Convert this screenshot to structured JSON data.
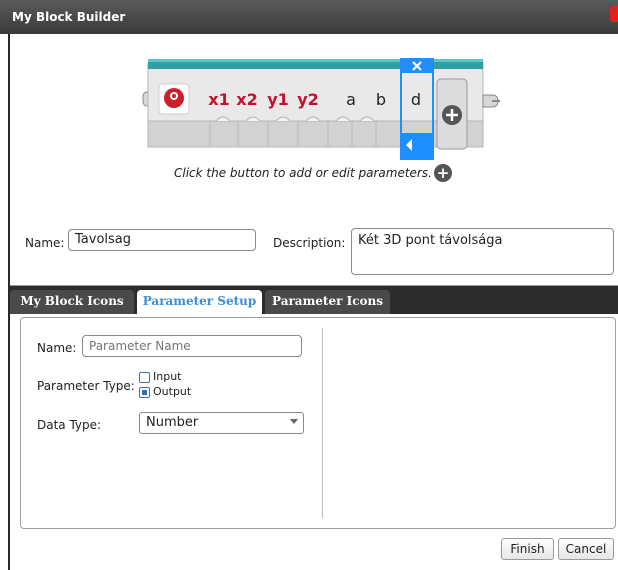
{
  "window": {
    "title": "My Block Builder"
  },
  "block": {
    "params": [
      "x1",
      "x2",
      "y1",
      "y2",
      "a",
      "b",
      "d"
    ],
    "param_colors": [
      "#c8102e",
      "#c8102e",
      "#c8102e",
      "#c8102e",
      "#222222",
      "#222222",
      "#222222"
    ],
    "selected_param_index": 6,
    "accent": "#2f9fa3",
    "selection_color": "#1f8fff"
  },
  "caption": "Click the button to add or edit parameters.",
  "name_label": "Name:",
  "name_value": "Tavolsag",
  "description_label": "Description:",
  "description_value": "Két 3D pont távolsága",
  "tabs": [
    {
      "label": "My Block Icons",
      "active": false
    },
    {
      "label": "Parameter Setup",
      "active": true
    },
    {
      "label": "Parameter Icons",
      "active": false
    }
  ],
  "param_setup": {
    "name_label": "Name:",
    "name_placeholder": "Parameter Name",
    "type_label": "Parameter Type:",
    "type_options": [
      {
        "label": "Input",
        "checked": false
      },
      {
        "label": "Output",
        "checked": true
      }
    ],
    "data_type_label": "Data Type:",
    "data_type_value": "Number"
  },
  "buttons": {
    "finish": "Finish",
    "cancel": "Cancel"
  },
  "icons": {
    "block_icon": "red-head-gears-icon",
    "add": "plus-circle-icon",
    "remove": "close-icon",
    "move_left": "triangle-left-icon",
    "dropdown": "chevron-down-icon"
  }
}
